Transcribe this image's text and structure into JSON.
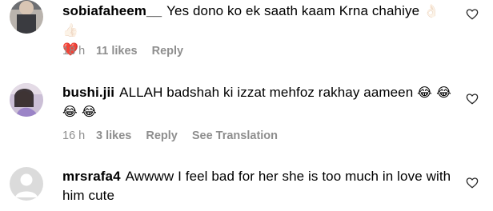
{
  "comments": [
    {
      "username": "sobiafaheem__",
      "text": "Yes dono ko ek saath kaam Krna chahiye",
      "emojis_line1": "👌🏻 👍🏻",
      "emojis_line2": "❤️",
      "time": "18 h",
      "likes": "11 likes",
      "reply": "Reply"
    },
    {
      "username": "bushi.jii",
      "text": "ALLAH badshah ki izzat mehfoz rakhay aameen",
      "emojis_line1": "😂 😂",
      "emojis_line2": "😂 😂",
      "time": "16 h",
      "likes": "3 likes",
      "reply": "Reply",
      "translate": "See Translation"
    },
    {
      "username": "mrsrafa4",
      "text": "Awwww I feel bad for her she is too much in love with him cute"
    }
  ],
  "icons": {
    "like": "heart-outline-icon",
    "avatar_placeholder": "default-avatar-icon"
  },
  "colors": {
    "meta": "#8e8e8e",
    "heart_red": "#ed4956"
  }
}
